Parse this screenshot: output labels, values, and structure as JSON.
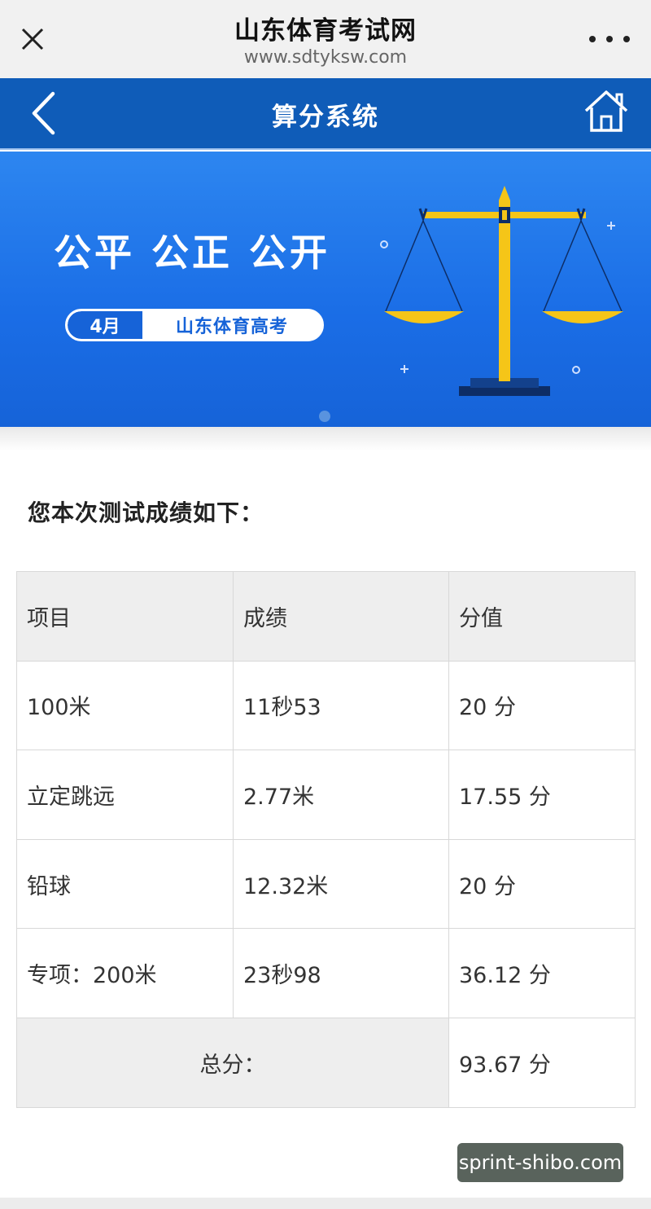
{
  "browser": {
    "title": "山东体育考试网",
    "url": "www.sdtyksw.com"
  },
  "nav": {
    "title": "算分系统"
  },
  "banner": {
    "slogan": "公平   公正   公开",
    "badge_month": "4月",
    "badge_text": "山东体育高考"
  },
  "result": {
    "heading": "您本次测试成绩如下：",
    "headers": [
      "项目",
      "成绩",
      "分值"
    ],
    "rows": [
      [
        "100米",
        "11秒53",
        "20 分"
      ],
      [
        "立定跳远",
        "2.77米",
        "17.55 分"
      ],
      [
        "铅球",
        "12.32米",
        "20 分"
      ],
      [
        "专项：200米",
        "23秒98",
        "36.12 分"
      ]
    ],
    "total_label": "总分：",
    "total_value": "93.67 分"
  },
  "watermark": "sprint-shibo.com",
  "colors": {
    "nav_blue": "#0f5cb8",
    "banner_blue": "#1a6de6",
    "scale_yellow": "#f5c518"
  },
  "icons": {
    "close": "close-icon",
    "more": "more-dots-icon",
    "back": "chevron-left-icon",
    "home": "home-icon"
  }
}
